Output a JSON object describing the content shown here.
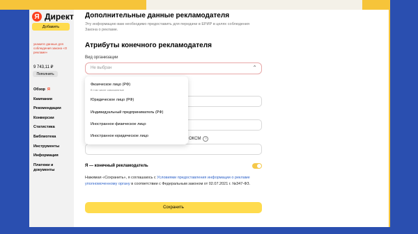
{
  "app": {
    "name": "Директ"
  },
  "sidebar": {
    "add_label": "Добавить",
    "warning": "укажите данные для соблюдения закона «О рекламе»",
    "balance": "9 743,11 ₽",
    "topup_label": "Пополнить",
    "items": [
      {
        "label": "Обзор",
        "badge": "Я"
      },
      {
        "label": "Кампании"
      },
      {
        "label": "Рекомендации"
      },
      {
        "label": "Конверсии"
      },
      {
        "label": "Статистика"
      },
      {
        "label": "Библиотека"
      },
      {
        "label": "Инструменты"
      },
      {
        "label": "Информация"
      },
      {
        "label": "Платежи и документы"
      }
    ]
  },
  "form": {
    "title": "Дополнительные данные рекламодателя",
    "description": "Эту информацию вам необходимо предоставить для передачи в ЕРИР в целях соблюдения Закона о рекламе.",
    "attributes_title": "Атрибуты конечного рекламодателя",
    "org_label": "Вид организации",
    "org_placeholder": "Не выбран",
    "oksm_label": "ОКСМ",
    "dropdown_options": [
      {
        "label": "Физическое лицо (РФ)",
        "sub": "В том числе самозанятые"
      },
      {
        "label": "Юридическое лицо (РФ)"
      },
      {
        "label": "Индивидуальный предприниматель (РФ)"
      },
      {
        "label": "Иностранное физическое лицо"
      },
      {
        "label": "Иностранное юридическое лицо"
      }
    ],
    "ack_label": "Я — конечный рекламодатель",
    "ack_enabled": true,
    "legal_prefix": "Нажимая «Сохранить», я соглашаюсь с ",
    "legal_link": "Условиями предоставления информации о рекламе уполномоченному органу",
    "legal_suffix": " в соответствии с Федеральным законом от 02.07.2021 г. №347-ФЗ.",
    "save_label": "Сохранить"
  },
  "colors": {
    "accent": "#ffdb4d",
    "brand": "#fc3f1d",
    "link": "#2e62c8",
    "frame_yellow": "#f6c43a",
    "frame_blue": "#2a4fb0"
  }
}
